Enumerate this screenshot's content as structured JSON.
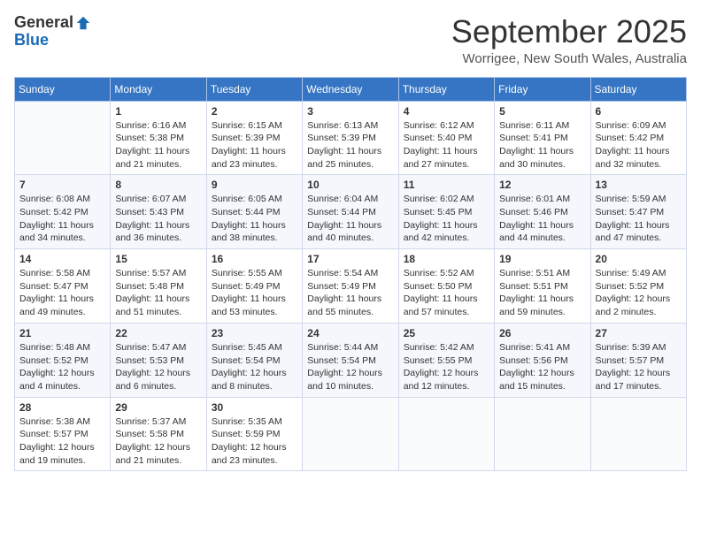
{
  "logo": {
    "general": "General",
    "blue": "Blue"
  },
  "title": "September 2025",
  "location": "Worrigee, New South Wales, Australia",
  "days_of_week": [
    "Sunday",
    "Monday",
    "Tuesday",
    "Wednesday",
    "Thursday",
    "Friday",
    "Saturday"
  ],
  "weeks": [
    [
      {
        "day": "",
        "info": ""
      },
      {
        "day": "1",
        "info": "Sunrise: 6:16 AM\nSunset: 5:38 PM\nDaylight: 11 hours\nand 21 minutes."
      },
      {
        "day": "2",
        "info": "Sunrise: 6:15 AM\nSunset: 5:39 PM\nDaylight: 11 hours\nand 23 minutes."
      },
      {
        "day": "3",
        "info": "Sunrise: 6:13 AM\nSunset: 5:39 PM\nDaylight: 11 hours\nand 25 minutes."
      },
      {
        "day": "4",
        "info": "Sunrise: 6:12 AM\nSunset: 5:40 PM\nDaylight: 11 hours\nand 27 minutes."
      },
      {
        "day": "5",
        "info": "Sunrise: 6:11 AM\nSunset: 5:41 PM\nDaylight: 11 hours\nand 30 minutes."
      },
      {
        "day": "6",
        "info": "Sunrise: 6:09 AM\nSunset: 5:42 PM\nDaylight: 11 hours\nand 32 minutes."
      }
    ],
    [
      {
        "day": "7",
        "info": "Sunrise: 6:08 AM\nSunset: 5:42 PM\nDaylight: 11 hours\nand 34 minutes."
      },
      {
        "day": "8",
        "info": "Sunrise: 6:07 AM\nSunset: 5:43 PM\nDaylight: 11 hours\nand 36 minutes."
      },
      {
        "day": "9",
        "info": "Sunrise: 6:05 AM\nSunset: 5:44 PM\nDaylight: 11 hours\nand 38 minutes."
      },
      {
        "day": "10",
        "info": "Sunrise: 6:04 AM\nSunset: 5:44 PM\nDaylight: 11 hours\nand 40 minutes."
      },
      {
        "day": "11",
        "info": "Sunrise: 6:02 AM\nSunset: 5:45 PM\nDaylight: 11 hours\nand 42 minutes."
      },
      {
        "day": "12",
        "info": "Sunrise: 6:01 AM\nSunset: 5:46 PM\nDaylight: 11 hours\nand 44 minutes."
      },
      {
        "day": "13",
        "info": "Sunrise: 5:59 AM\nSunset: 5:47 PM\nDaylight: 11 hours\nand 47 minutes."
      }
    ],
    [
      {
        "day": "14",
        "info": "Sunrise: 5:58 AM\nSunset: 5:47 PM\nDaylight: 11 hours\nand 49 minutes."
      },
      {
        "day": "15",
        "info": "Sunrise: 5:57 AM\nSunset: 5:48 PM\nDaylight: 11 hours\nand 51 minutes."
      },
      {
        "day": "16",
        "info": "Sunrise: 5:55 AM\nSunset: 5:49 PM\nDaylight: 11 hours\nand 53 minutes."
      },
      {
        "day": "17",
        "info": "Sunrise: 5:54 AM\nSunset: 5:49 PM\nDaylight: 11 hours\nand 55 minutes."
      },
      {
        "day": "18",
        "info": "Sunrise: 5:52 AM\nSunset: 5:50 PM\nDaylight: 11 hours\nand 57 minutes."
      },
      {
        "day": "19",
        "info": "Sunrise: 5:51 AM\nSunset: 5:51 PM\nDaylight: 11 hours\nand 59 minutes."
      },
      {
        "day": "20",
        "info": "Sunrise: 5:49 AM\nSunset: 5:52 PM\nDaylight: 12 hours\nand 2 minutes."
      }
    ],
    [
      {
        "day": "21",
        "info": "Sunrise: 5:48 AM\nSunset: 5:52 PM\nDaylight: 12 hours\nand 4 minutes."
      },
      {
        "day": "22",
        "info": "Sunrise: 5:47 AM\nSunset: 5:53 PM\nDaylight: 12 hours\nand 6 minutes."
      },
      {
        "day": "23",
        "info": "Sunrise: 5:45 AM\nSunset: 5:54 PM\nDaylight: 12 hours\nand 8 minutes."
      },
      {
        "day": "24",
        "info": "Sunrise: 5:44 AM\nSunset: 5:54 PM\nDaylight: 12 hours\nand 10 minutes."
      },
      {
        "day": "25",
        "info": "Sunrise: 5:42 AM\nSunset: 5:55 PM\nDaylight: 12 hours\nand 12 minutes."
      },
      {
        "day": "26",
        "info": "Sunrise: 5:41 AM\nSunset: 5:56 PM\nDaylight: 12 hours\nand 15 minutes."
      },
      {
        "day": "27",
        "info": "Sunrise: 5:39 AM\nSunset: 5:57 PM\nDaylight: 12 hours\nand 17 minutes."
      }
    ],
    [
      {
        "day": "28",
        "info": "Sunrise: 5:38 AM\nSunset: 5:57 PM\nDaylight: 12 hours\nand 19 minutes."
      },
      {
        "day": "29",
        "info": "Sunrise: 5:37 AM\nSunset: 5:58 PM\nDaylight: 12 hours\nand 21 minutes."
      },
      {
        "day": "30",
        "info": "Sunrise: 5:35 AM\nSunset: 5:59 PM\nDaylight: 12 hours\nand 23 minutes."
      },
      {
        "day": "",
        "info": ""
      },
      {
        "day": "",
        "info": ""
      },
      {
        "day": "",
        "info": ""
      },
      {
        "day": "",
        "info": ""
      }
    ]
  ]
}
